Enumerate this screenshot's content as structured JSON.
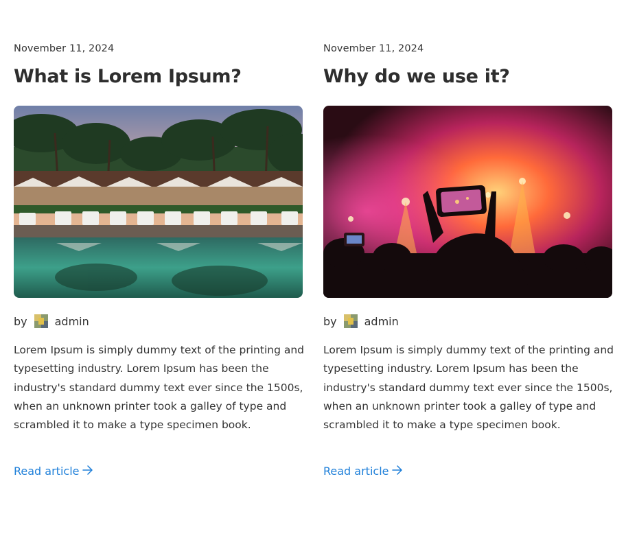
{
  "posts": [
    {
      "date": "November 11, 2024",
      "title": "What is Lorem Ipsum?",
      "by_label": "by",
      "author": "admin",
      "excerpt": "Lorem Ipsum is simply dummy text of the printing and typesetting industry. Lorem Ipsum has been the industry's standard dummy text ever since the 1500s, when an unknown printer took a galley of type and scrambled it to make a type specimen book.",
      "read_label": "Read article",
      "image_subject": "resort pool with palm trees and loungers"
    },
    {
      "date": "November 11, 2024",
      "title": "Why do we use it?",
      "by_label": "by",
      "author": "admin",
      "excerpt": "Lorem Ipsum is simply dummy text of the printing and typesetting industry. Lorem Ipsum has been the industry's standard dummy text ever since the 1500s, when an unknown printer took a galley of type and scrambled it to make a type specimen book.",
      "read_label": "Read article",
      "image_subject": "concert crowd filming stage with phone"
    }
  ],
  "icons": {
    "read_arrow": "arrow-right-icon"
  },
  "colors": {
    "link": "#1e7fd9",
    "text": "#333333",
    "title": "#2e2e2e"
  }
}
